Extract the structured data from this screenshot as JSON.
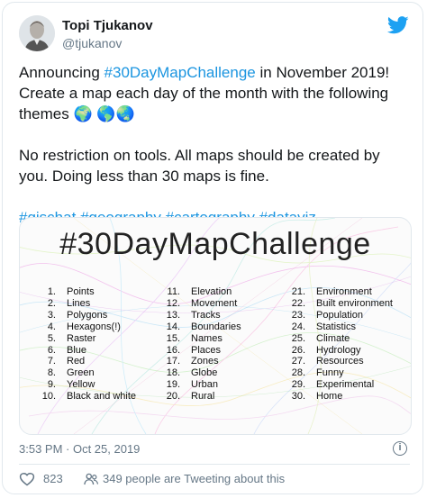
{
  "author": {
    "name": "Topi Tjukanov",
    "handle": "@tjukanov"
  },
  "tweet": {
    "line1_before": "Announcing ",
    "line1_hashtag": "#30DayMapChallenge",
    "line1_after": " in November 2019! Create a map each day of the month with the following themes",
    "globe_1": "🌍",
    "globe_2": "🌎",
    "globe_3": "🌏",
    "paragraph2": "No restriction on tools. All maps should be created by you. Doing less than 30 maps is fine.",
    "hashtags": [
      "#gischat",
      "#geography",
      "#cartography",
      "#dataviz"
    ]
  },
  "media": {
    "title": "#30DayMapChallenge",
    "themes": [
      {
        "n": "1.",
        "t": "Points"
      },
      {
        "n": "2.",
        "t": "Lines"
      },
      {
        "n": "3.",
        "t": "Polygons"
      },
      {
        "n": "4.",
        "t": "Hexagons(!)"
      },
      {
        "n": "5.",
        "t": "Raster"
      },
      {
        "n": "6.",
        "t": "Blue"
      },
      {
        "n": "7.",
        "t": "Red"
      },
      {
        "n": "8.",
        "t": "Green"
      },
      {
        "n": "9.",
        "t": "Yellow"
      },
      {
        "n": "10.",
        "t": "Black and white"
      },
      {
        "n": "11.",
        "t": "Elevation"
      },
      {
        "n": "12.",
        "t": "Movement"
      },
      {
        "n": "13.",
        "t": "Tracks"
      },
      {
        "n": "14.",
        "t": "Boundaries"
      },
      {
        "n": "15.",
        "t": "Names"
      },
      {
        "n": "16.",
        "t": "Places"
      },
      {
        "n": "17.",
        "t": "Zones"
      },
      {
        "n": "18.",
        "t": "Globe"
      },
      {
        "n": "19.",
        "t": "Urban"
      },
      {
        "n": "20.",
        "t": "Rural"
      },
      {
        "n": "21.",
        "t": "Environment"
      },
      {
        "n": "22.",
        "t": "Built environment"
      },
      {
        "n": "23.",
        "t": "Population"
      },
      {
        "n": "24.",
        "t": "Statistics"
      },
      {
        "n": "25.",
        "t": "Climate"
      },
      {
        "n": "26.",
        "t": "Hydrology"
      },
      {
        "n": "27.",
        "t": "Resources"
      },
      {
        "n": "28.",
        "t": "Funny"
      },
      {
        "n": "29.",
        "t": "Experimental"
      },
      {
        "n": "30.",
        "t": "Home"
      }
    ]
  },
  "footer": {
    "timestamp": "3:53 PM · Oct 25, 2019",
    "info_glyph": "i",
    "like_count": "823",
    "people_text": "349 people are Tweeting about this"
  },
  "colors": {
    "link": "#1b95e0",
    "twitter_blue": "#1da1f2",
    "secondary_text": "#657786",
    "border": "#e1e8ed"
  },
  "icons": [
    "avatar",
    "twitter-bird-icon",
    "info-icon",
    "heart-icon",
    "people-icon"
  ]
}
